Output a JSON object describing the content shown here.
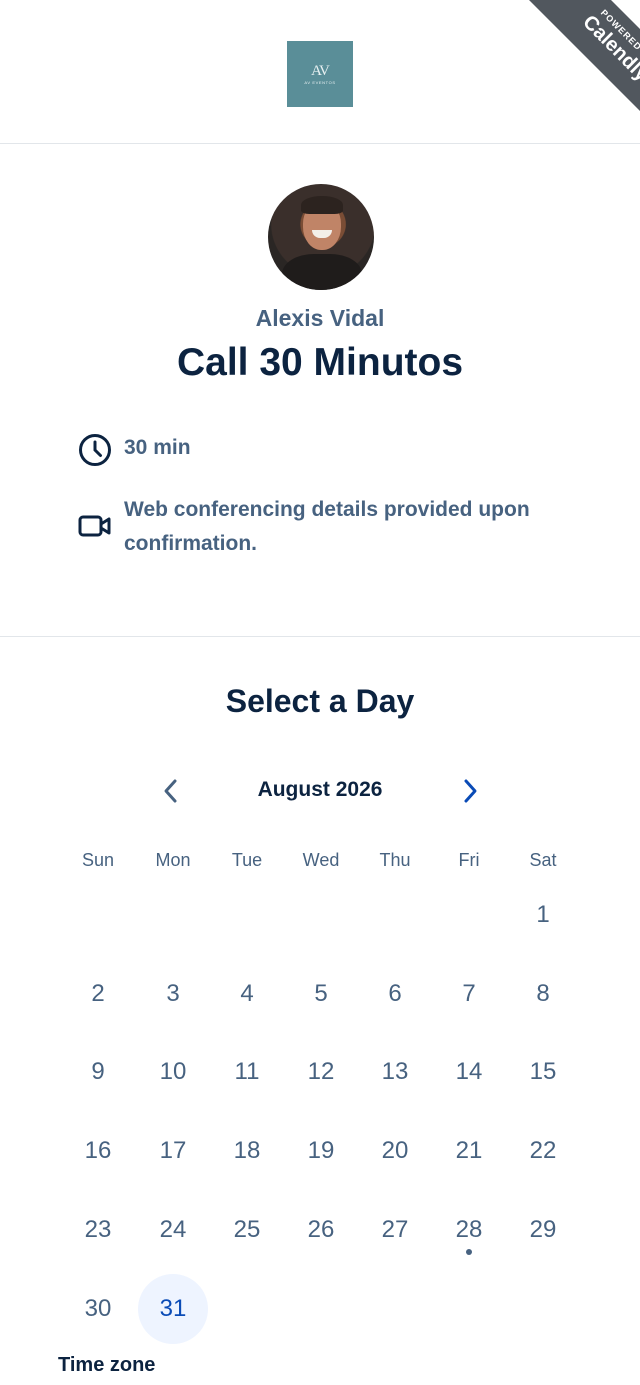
{
  "header": {
    "logo_monogram": "AV",
    "logo_subtext": "AV EVENTOS",
    "badge_powered": "POWERED BY",
    "badge_brand": "Calendly"
  },
  "event": {
    "host_name": "Alexis Vidal",
    "title": "Call 30 Minutos",
    "duration": "30 min",
    "location_line1": "Web conferencing details provided upon",
    "location_line2": "confirmation."
  },
  "calendar": {
    "heading": "Select a Day",
    "month_label": "August 2026",
    "weekdays": [
      "Sun",
      "Mon",
      "Tue",
      "Wed",
      "Thu",
      "Fri",
      "Sat"
    ],
    "days": [
      "1",
      "2",
      "3",
      "4",
      "5",
      "6",
      "7",
      "8",
      "9",
      "10",
      "11",
      "12",
      "13",
      "14",
      "15",
      "16",
      "17",
      "18",
      "19",
      "20",
      "21",
      "22",
      "23",
      "24",
      "25",
      "26",
      "27",
      "28",
      "29",
      "30",
      "31"
    ],
    "first_weekday_index": 6,
    "selected_day": "31",
    "today_marker_day": "28"
  },
  "timezone": {
    "label": "Time zone"
  },
  "colors": {
    "logo_bg": "#5a8e98",
    "ribbon_bg": "#51575e",
    "heading": "#0c2340",
    "secondary_text": "#476280",
    "accent": "#0a4bb6",
    "selected_bg": "#eef4ff"
  },
  "icons": {
    "duration": "clock-icon",
    "location": "video-camera-icon",
    "prev": "chevron-left-icon",
    "next": "chevron-right-icon"
  }
}
